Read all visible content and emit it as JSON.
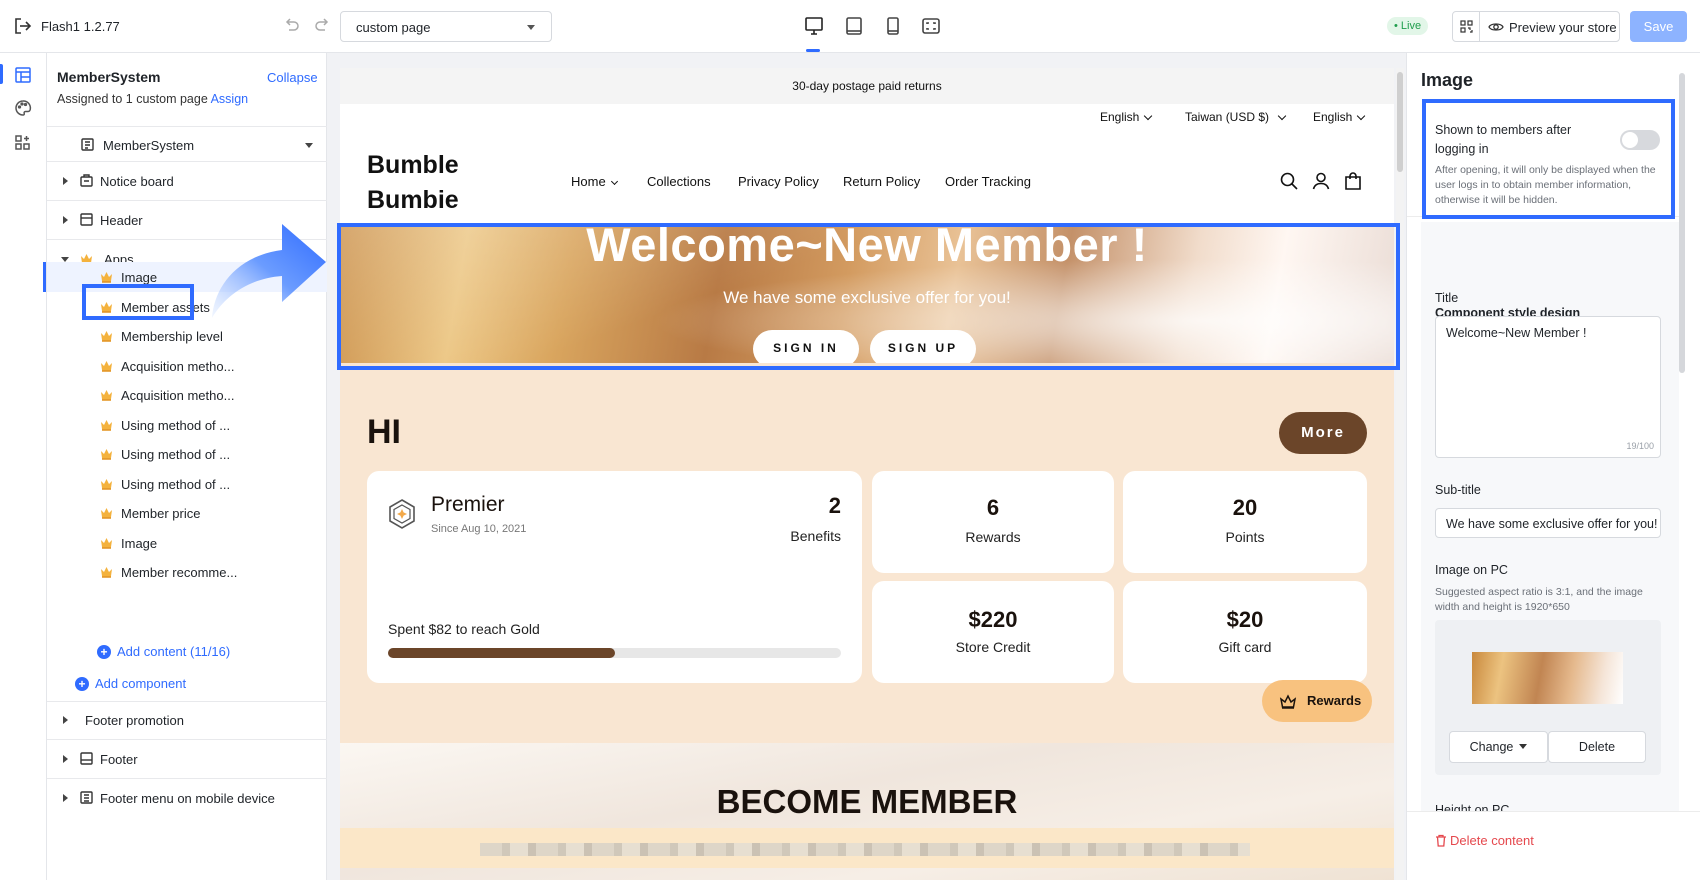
{
  "topbar": {
    "app_version": "Flash1  1.2.77",
    "page_select": "custom page",
    "live_badge": "• Live",
    "preview_label": "Preview your store",
    "save_label": "Save"
  },
  "left_panel": {
    "title": "MemberSystem",
    "collapse": "Collapse",
    "assigned_text": "Assigned to 1 custom page",
    "assign_link": "Assign",
    "page_name": "MemberSystem",
    "sections_top": [
      "Notice board",
      "Header",
      "Apps"
    ],
    "apps_items": [
      "Image",
      "Member assets",
      "Membership level",
      "Acquisition metho...",
      "Acquisition metho...",
      "Using method of ...",
      "Using method of ...",
      "Using method of ...",
      "Member price",
      "Image",
      "Member recomme..."
    ],
    "add_content": "Add content (11/16)",
    "add_component": "Add component",
    "sections_bottom": [
      "Footer promotion",
      "Footer",
      "Footer menu on mobile device"
    ]
  },
  "canvas": {
    "announcement": "30-day postage paid returns",
    "lang1": "English",
    "region": "Taiwan  (USD $)",
    "lang2": "English",
    "brand_line1": "Bumble",
    "brand_line2": "Bumbie",
    "nav": [
      "Home",
      "Collections",
      "Privacy Policy",
      "Return Policy",
      "Order Tracking"
    ],
    "banner_title": "Welcome~New Member !",
    "banner_subtitle": "We have some exclusive offer for you!",
    "sign_in": "SIGN IN",
    "sign_up": "SIGN UP",
    "hi": "HI",
    "more": "More",
    "tier_name": "Premier",
    "tier_since": "Since Aug 10, 2021",
    "benefits_count": "2",
    "benefits_label": "Benefits",
    "spent_text": "Spent $82 to reach Gold",
    "progress": 0.5,
    "stats": [
      {
        "value": "6",
        "label": "Rewards"
      },
      {
        "value": "20",
        "label": "Points"
      },
      {
        "value": "$220",
        "label": "Store Credit"
      },
      {
        "value": "$20",
        "label": "Gift card"
      }
    ],
    "rewards_fab": "Rewards",
    "become_title": "BECOME MEMBER"
  },
  "right_panel": {
    "title": "Image",
    "toggle_label": "Shown to members after logging in",
    "toggle_on": false,
    "toggle_help": "After opening, it will only be displayed when the user logs in to obtain member information, otherwise it will be hidden.",
    "section_heading": "Component style design",
    "title_label": "Title",
    "title_value": "Welcome~New Member !",
    "title_count": "19/100",
    "subtitle_label": "Sub-title",
    "subtitle_value": "We have some exclusive offer for you!",
    "image_pc_label": "Image on PC",
    "image_pc_help": "Suggested aspect ratio is 3:1, and the image width and height is 1920*650",
    "change_btn": "Change",
    "delete_btn": "Delete",
    "height_label": "Height on PC",
    "delete_content": "Delete content"
  },
  "colors": {
    "accent": "#2f6bff",
    "brown": "#6b4529",
    "peach": "#f9e6d2",
    "danger": "#e5484d"
  }
}
